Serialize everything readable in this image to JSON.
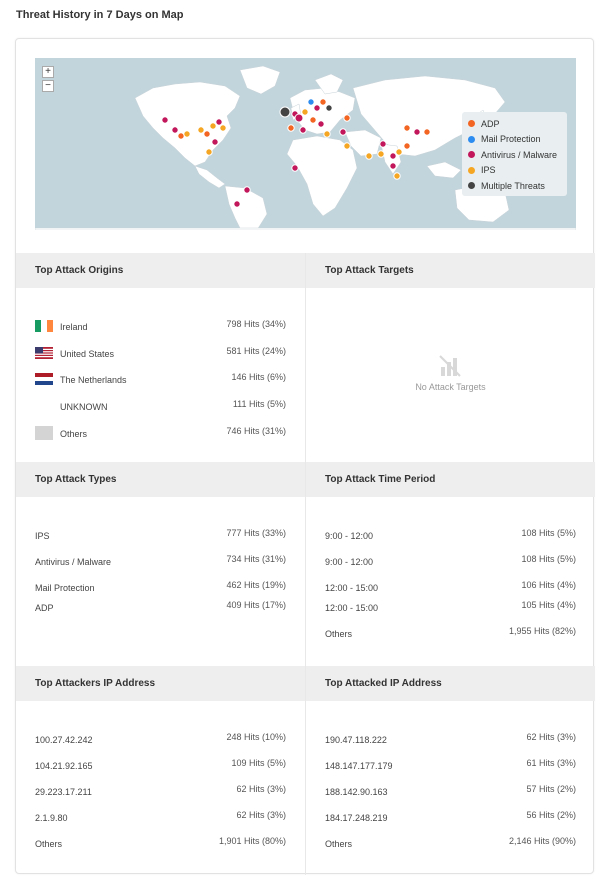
{
  "page_title": "Threat History in 7 Days on Map",
  "map": {
    "zoom_in": "+",
    "zoom_out": "−",
    "legend": [
      {
        "label": "ADP",
        "color": "#f26522"
      },
      {
        "label": "Mail Protection",
        "color": "#2d8cf0"
      },
      {
        "label": "Antivirus / Malware",
        "color": "#c2185b"
      },
      {
        "label": "IPS",
        "color": "#f5a623"
      },
      {
        "label": "Multiple Threats",
        "color": "#444444"
      }
    ]
  },
  "origins": {
    "title": "Top Attack Origins",
    "rows": [
      {
        "label": "Ireland",
        "value": "798 Hits (34%)"
      },
      {
        "label": "United States",
        "value": "581 Hits (24%)"
      },
      {
        "label": "The Netherlands",
        "value": "146 Hits (6%)"
      },
      {
        "label": "UNKNOWN",
        "value": "111 Hits (5%)"
      },
      {
        "label": "Others",
        "value": "746 Hits (31%)"
      }
    ]
  },
  "targets": {
    "title": "Top Attack Targets",
    "empty_text": "No Attack Targets"
  },
  "types": {
    "title": "Top Attack Types",
    "rows": [
      {
        "label": "IPS",
        "value": "777 Hits (33%)"
      },
      {
        "label": "Antivirus / Malware",
        "value": "734 Hits (31%)"
      },
      {
        "label": "Mail Protection",
        "value": "462 Hits (19%)"
      },
      {
        "label": "ADP",
        "value": "409 Hits (17%)"
      }
    ]
  },
  "time_period": {
    "title": "Top Attack Time Period",
    "rows": [
      {
        "label": "9:00 - 12:00",
        "value": "108 Hits (5%)"
      },
      {
        "label": "9:00 - 12:00",
        "value": "108 Hits (5%)"
      },
      {
        "label": "12:00 - 15:00",
        "value": "106 Hits (4%)"
      },
      {
        "label": "12:00 - 15:00",
        "value": "105 Hits (4%)"
      },
      {
        "label": "Others",
        "value": "1,955 Hits (82%)"
      }
    ]
  },
  "attackers_ip": {
    "title": "Top Attackers IP Address",
    "rows": [
      {
        "label": "100.27.42.242",
        "value": "248 Hits (10%)"
      },
      {
        "label": "104.21.92.165",
        "value": "109 Hits (5%)"
      },
      {
        "label": "29.223.17.211",
        "value": "62 Hits (3%)"
      },
      {
        "label": "2.1.9.80",
        "value": "62 Hits (3%)"
      },
      {
        "label": "Others",
        "value": "1,901 Hits (80%)"
      }
    ]
  },
  "attacked_ip": {
    "title": "Top Attacked IP Address",
    "rows": [
      {
        "label": "190.47.118.222",
        "value": "62 Hits (3%)"
      },
      {
        "label": "148.147.177.179",
        "value": "61 Hits (3%)"
      },
      {
        "label": "188.142.90.163",
        "value": "57 Hits (2%)"
      },
      {
        "label": "184.17.248.219",
        "value": "56 Hits (2%)"
      },
      {
        "label": "Others",
        "value": "2,146 Hits (90%)"
      }
    ]
  }
}
